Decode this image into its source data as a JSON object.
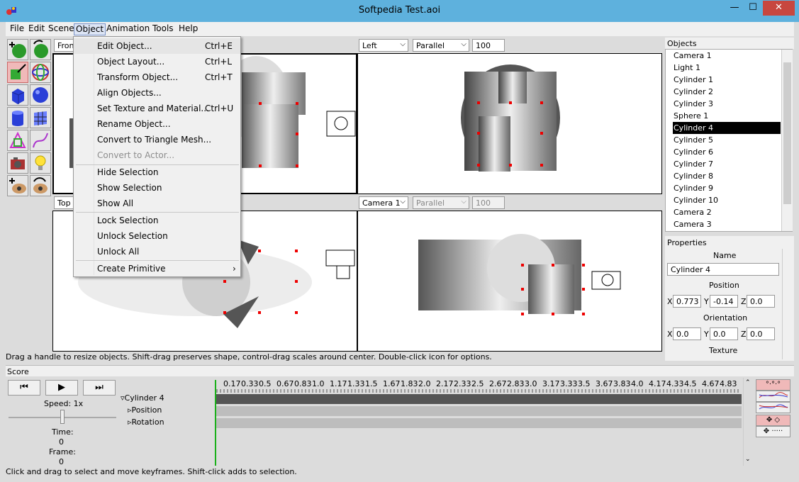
{
  "window": {
    "title": "Softpedia Test.aoi",
    "min": "—",
    "max": "☐",
    "close": "✕"
  },
  "menubar": {
    "items": [
      "File",
      "Edit",
      "Scene",
      "Object",
      "Animation",
      "Tools",
      "Help"
    ],
    "open": "Object"
  },
  "object_menu": {
    "items": [
      {
        "label": "Edit Object...",
        "shortcut": "Ctrl+E"
      },
      {
        "label": "Object Layout...",
        "shortcut": "Ctrl+L"
      },
      {
        "label": "Transform Object...",
        "shortcut": "Ctrl+T"
      },
      {
        "label": "Align Objects...",
        "shortcut": ""
      },
      {
        "label": "Set Texture and Material...",
        "shortcut": "Ctrl+U"
      },
      {
        "label": "Rename Object...",
        "shortcut": ""
      },
      {
        "label": "Convert to Triangle Mesh...",
        "shortcut": ""
      },
      {
        "label": "Convert to Actor...",
        "shortcut": ""
      },
      {
        "label": "Hide Selection",
        "shortcut": ""
      },
      {
        "label": "Show Selection",
        "shortcut": ""
      },
      {
        "label": "Show All",
        "shortcut": ""
      },
      {
        "label": "Lock Selection",
        "shortcut": ""
      },
      {
        "label": "Unlock Selection",
        "shortcut": ""
      },
      {
        "label": "Unlock All",
        "shortcut": ""
      },
      {
        "label": "Create Primitive",
        "shortcut": "",
        "submenu_arrow": "›"
      }
    ]
  },
  "viewports": {
    "top_left": {
      "view": "Front"
    },
    "top_right": {
      "view": "Left",
      "projection": "Parallel",
      "scale": "100"
    },
    "bottom_left": {
      "view": "Top"
    },
    "bottom_right": {
      "view": "Camera 1",
      "projection": "Parallel",
      "scale": "100"
    }
  },
  "objects_panel": {
    "title": "Objects",
    "items": [
      "Camera 1",
      "Light 1",
      "Cylinder 1",
      "Cylinder 2",
      "Cylinder 3",
      "Sphere 1",
      "Cylinder 4",
      "Cylinder 5",
      "Cylinder 6",
      "Cylinder 7",
      "Cylinder 8",
      "Cylinder 9",
      "Cylinder 10",
      "Camera 2",
      "Camera 3"
    ],
    "selected": "Cylinder 4"
  },
  "properties_panel": {
    "title": "Properties",
    "name_label": "Name",
    "name_value": "Cylinder 4",
    "position_label": "Position",
    "position": {
      "x": "0.773",
      "y": "-0.14",
      "z": "0.0"
    },
    "orientation_label": "Orientation",
    "orientation": {
      "x": "0.0",
      "y": "0.0",
      "z": "0.0"
    },
    "texture_label": "Texture",
    "axis_x": "X",
    "axis_y": "Y",
    "axis_z": "Z"
  },
  "status_top": "Drag a handle to resize objects.  Shift-drag preserves shape, control-drag scales around center.  Double-click icon for options.",
  "score": {
    "title": "Score",
    "buttons": {
      "rewind": "⏮",
      "play": "▶",
      "forward": "⏭"
    },
    "speed_label": "Speed: 1x",
    "time_label": "Time:",
    "time_value": "0",
    "frame_label": "Frame:",
    "frame_value": "0",
    "tree": {
      "root": "Cylinder 4",
      "children": [
        "Position",
        "Rotation"
      ]
    },
    "ruler": [
      "0.17",
      "0.33",
      "0.5",
      "0.67",
      "0.83",
      "1.0",
      "1.17",
      "1.33",
      "1.5",
      "1.67",
      "1.83",
      "2.0",
      "2.17",
      "2.33",
      "2.5",
      "2.67",
      "2.83",
      "3.0",
      "3.17",
      "3.33",
      "3.5",
      "3.67",
      "3.83",
      "4.0",
      "4.17",
      "4.33",
      "4.5",
      "4.67",
      "4.83"
    ]
  },
  "status_bottom": "Click and drag to select and move keyframes.  Shift-click adds to selection."
}
